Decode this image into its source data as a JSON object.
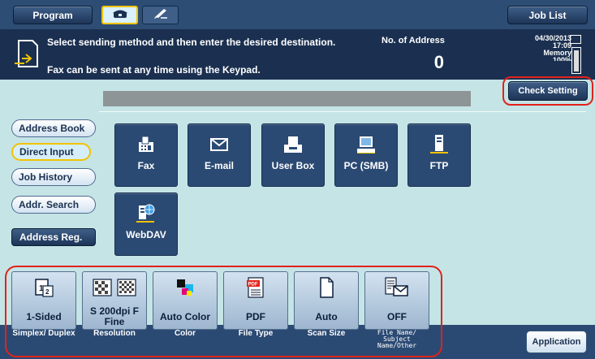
{
  "header": {
    "program_label": "Program",
    "job_list_label": "Job List"
  },
  "message": {
    "line1": "Select sending method and then enter the desired destination.",
    "line2": "Fax can be sent at any time using the Keypad.",
    "address_count_label": "No. of Address",
    "address_count": "0"
  },
  "status": {
    "date": "04/30/2013",
    "time": "17:09",
    "memory_label": "Memory",
    "memory_value": "100%"
  },
  "check_setting_label": "Check Setting",
  "left_nav": [
    {
      "label": "Address Book"
    },
    {
      "label": "Direct Input"
    },
    {
      "label": "Job History"
    },
    {
      "label": "Addr. Search"
    },
    {
      "label": "Address Reg."
    }
  ],
  "destinations": [
    {
      "label": "Fax",
      "icon": "fax-icon"
    },
    {
      "label": "E-mail",
      "icon": "email-icon"
    },
    {
      "label": "User Box",
      "icon": "user-box-icon"
    },
    {
      "label": "PC (SMB)",
      "icon": "pc-icon"
    },
    {
      "label": "FTP",
      "icon": "ftp-icon"
    },
    {
      "label": "WebDAV",
      "icon": "webdav-icon"
    }
  ],
  "settings": [
    {
      "value": "1-Sided",
      "caption": "Simplex/ Duplex",
      "icon": "simplex-icon"
    },
    {
      "value": "S 200dpi F Fine",
      "caption": "Resolution",
      "icon": "resolution-icon"
    },
    {
      "value": "Auto Color",
      "caption": "Color",
      "icon": "color-icon"
    },
    {
      "value": "PDF",
      "caption": "File Type",
      "icon": "pdf-icon"
    },
    {
      "value": "Auto",
      "caption": "Scan Size",
      "icon": "scan-size-icon"
    },
    {
      "value": "OFF",
      "caption": "File Name/ Subject Name/Other",
      "icon": "file-name-icon"
    }
  ],
  "application_label": "Application",
  "colors": {
    "topbar": "#2d4d74",
    "message_bar": "#1b3050",
    "main_bg": "#c5e4e6",
    "highlight_ring": "#e0231c",
    "active_outline": "#f1c300"
  }
}
